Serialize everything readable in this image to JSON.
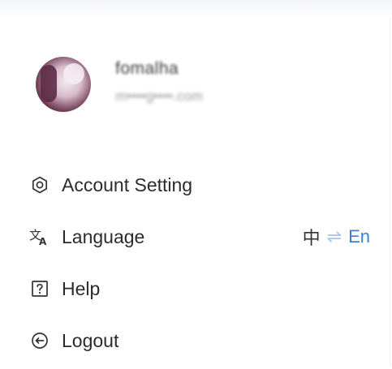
{
  "profile": {
    "name": "fomalha",
    "email": "m••••g••••.com"
  },
  "menu": {
    "items": [
      {
        "label": "Account Setting",
        "icon": "settings-ring-icon"
      },
      {
        "label": "Language",
        "icon": "translate-icon"
      },
      {
        "label": "Help",
        "icon": "question-box-icon"
      },
      {
        "label": "Logout",
        "icon": "logout-icon"
      }
    ]
  },
  "language": {
    "current": "中",
    "swap": "⇌",
    "alternate": "En"
  },
  "colors": {
    "accent": "#3d7fd6",
    "swap_icon": "#a8c4ec",
    "text": "#2b2b2b"
  }
}
